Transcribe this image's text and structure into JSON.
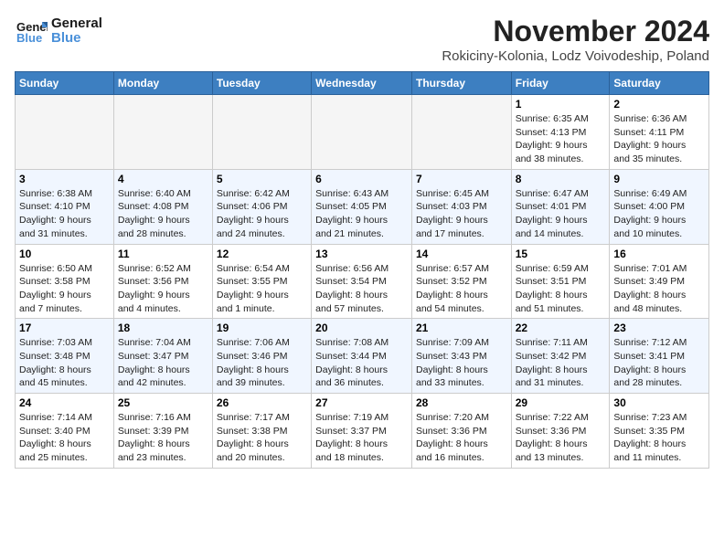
{
  "header": {
    "logo_line1": "General",
    "logo_line2": "Blue",
    "month_title": "November 2024",
    "location": "Rokiciny-Kolonia, Lodz Voivodeship, Poland"
  },
  "weekdays": [
    "Sunday",
    "Monday",
    "Tuesday",
    "Wednesday",
    "Thursday",
    "Friday",
    "Saturday"
  ],
  "weeks": [
    [
      {
        "day": "",
        "info": ""
      },
      {
        "day": "",
        "info": ""
      },
      {
        "day": "",
        "info": ""
      },
      {
        "day": "",
        "info": ""
      },
      {
        "day": "",
        "info": ""
      },
      {
        "day": "1",
        "info": "Sunrise: 6:35 AM\nSunset: 4:13 PM\nDaylight: 9 hours\nand 38 minutes."
      },
      {
        "day": "2",
        "info": "Sunrise: 6:36 AM\nSunset: 4:11 PM\nDaylight: 9 hours\nand 35 minutes."
      }
    ],
    [
      {
        "day": "3",
        "info": "Sunrise: 6:38 AM\nSunset: 4:10 PM\nDaylight: 9 hours\nand 31 minutes."
      },
      {
        "day": "4",
        "info": "Sunrise: 6:40 AM\nSunset: 4:08 PM\nDaylight: 9 hours\nand 28 minutes."
      },
      {
        "day": "5",
        "info": "Sunrise: 6:42 AM\nSunset: 4:06 PM\nDaylight: 9 hours\nand 24 minutes."
      },
      {
        "day": "6",
        "info": "Sunrise: 6:43 AM\nSunset: 4:05 PM\nDaylight: 9 hours\nand 21 minutes."
      },
      {
        "day": "7",
        "info": "Sunrise: 6:45 AM\nSunset: 4:03 PM\nDaylight: 9 hours\nand 17 minutes."
      },
      {
        "day": "8",
        "info": "Sunrise: 6:47 AM\nSunset: 4:01 PM\nDaylight: 9 hours\nand 14 minutes."
      },
      {
        "day": "9",
        "info": "Sunrise: 6:49 AM\nSunset: 4:00 PM\nDaylight: 9 hours\nand 10 minutes."
      }
    ],
    [
      {
        "day": "10",
        "info": "Sunrise: 6:50 AM\nSunset: 3:58 PM\nDaylight: 9 hours\nand 7 minutes."
      },
      {
        "day": "11",
        "info": "Sunrise: 6:52 AM\nSunset: 3:56 PM\nDaylight: 9 hours\nand 4 minutes."
      },
      {
        "day": "12",
        "info": "Sunrise: 6:54 AM\nSunset: 3:55 PM\nDaylight: 9 hours\nand 1 minute."
      },
      {
        "day": "13",
        "info": "Sunrise: 6:56 AM\nSunset: 3:54 PM\nDaylight: 8 hours\nand 57 minutes."
      },
      {
        "day": "14",
        "info": "Sunrise: 6:57 AM\nSunset: 3:52 PM\nDaylight: 8 hours\nand 54 minutes."
      },
      {
        "day": "15",
        "info": "Sunrise: 6:59 AM\nSunset: 3:51 PM\nDaylight: 8 hours\nand 51 minutes."
      },
      {
        "day": "16",
        "info": "Sunrise: 7:01 AM\nSunset: 3:49 PM\nDaylight: 8 hours\nand 48 minutes."
      }
    ],
    [
      {
        "day": "17",
        "info": "Sunrise: 7:03 AM\nSunset: 3:48 PM\nDaylight: 8 hours\nand 45 minutes."
      },
      {
        "day": "18",
        "info": "Sunrise: 7:04 AM\nSunset: 3:47 PM\nDaylight: 8 hours\nand 42 minutes."
      },
      {
        "day": "19",
        "info": "Sunrise: 7:06 AM\nSunset: 3:46 PM\nDaylight: 8 hours\nand 39 minutes."
      },
      {
        "day": "20",
        "info": "Sunrise: 7:08 AM\nSunset: 3:44 PM\nDaylight: 8 hours\nand 36 minutes."
      },
      {
        "day": "21",
        "info": "Sunrise: 7:09 AM\nSunset: 3:43 PM\nDaylight: 8 hours\nand 33 minutes."
      },
      {
        "day": "22",
        "info": "Sunrise: 7:11 AM\nSunset: 3:42 PM\nDaylight: 8 hours\nand 31 minutes."
      },
      {
        "day": "23",
        "info": "Sunrise: 7:12 AM\nSunset: 3:41 PM\nDaylight: 8 hours\nand 28 minutes."
      }
    ],
    [
      {
        "day": "24",
        "info": "Sunrise: 7:14 AM\nSunset: 3:40 PM\nDaylight: 8 hours\nand 25 minutes."
      },
      {
        "day": "25",
        "info": "Sunrise: 7:16 AM\nSunset: 3:39 PM\nDaylight: 8 hours\nand 23 minutes."
      },
      {
        "day": "26",
        "info": "Sunrise: 7:17 AM\nSunset: 3:38 PM\nDaylight: 8 hours\nand 20 minutes."
      },
      {
        "day": "27",
        "info": "Sunrise: 7:19 AM\nSunset: 3:37 PM\nDaylight: 8 hours\nand 18 minutes."
      },
      {
        "day": "28",
        "info": "Sunrise: 7:20 AM\nSunset: 3:36 PM\nDaylight: 8 hours\nand 16 minutes."
      },
      {
        "day": "29",
        "info": "Sunrise: 7:22 AM\nSunset: 3:36 PM\nDaylight: 8 hours\nand 13 minutes."
      },
      {
        "day": "30",
        "info": "Sunrise: 7:23 AM\nSunset: 3:35 PM\nDaylight: 8 hours\nand 11 minutes."
      }
    ]
  ]
}
